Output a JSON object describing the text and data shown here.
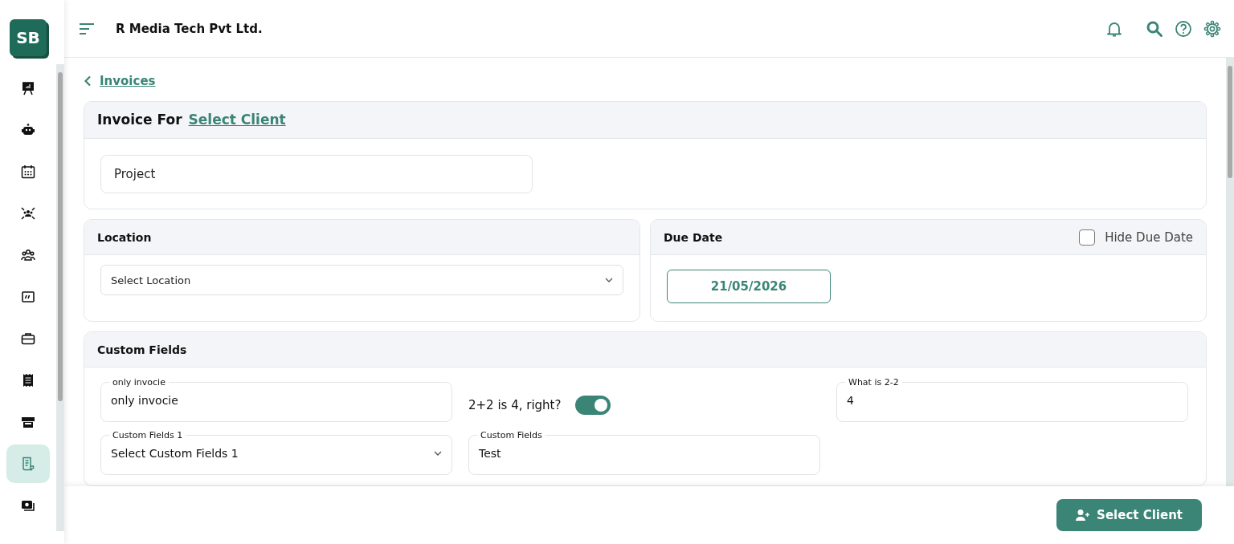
{
  "sidebar": {
    "logo": "SB",
    "items": [
      {
        "selected": false
      },
      {
        "selected": false
      },
      {
        "selected": false
      },
      {
        "selected": false
      },
      {
        "selected": false
      },
      {
        "selected": false
      },
      {
        "selected": false
      },
      {
        "selected": false
      },
      {
        "selected": false
      },
      {
        "selected": true
      },
      {
        "selected": false
      }
    ]
  },
  "company": "R Media Tech Pvt Ltd.",
  "breadcrumb": {
    "back_label": "Invoices"
  },
  "invoice_for": {
    "title": "Invoice For",
    "link": "Select Client",
    "project": {
      "placeholder": "Project"
    }
  },
  "location": {
    "title": "Location",
    "select": {
      "placeholder": "Select Location"
    }
  },
  "due_date": {
    "title": "Due Date",
    "hide": {
      "label": "Hide Due Date",
      "checked": false
    },
    "value": "21/05/2026"
  },
  "custom_fields": {
    "title": "Custom Fields",
    "fields": [
      {
        "kind": "text",
        "label": "only invocie",
        "value": "only invocie"
      },
      {
        "kind": "toggle",
        "label": "2+2 is 4, right?",
        "on": true
      },
      {
        "kind": "text",
        "label": "What is 2-2",
        "value": "4"
      },
      {
        "kind": "select",
        "label": "Custom Fields 1",
        "value": "Select Custom Fields 1"
      },
      {
        "kind": "text",
        "label": "Custom Fields",
        "value": "Test"
      }
    ]
  },
  "footer": {
    "button": "Select Client"
  }
}
